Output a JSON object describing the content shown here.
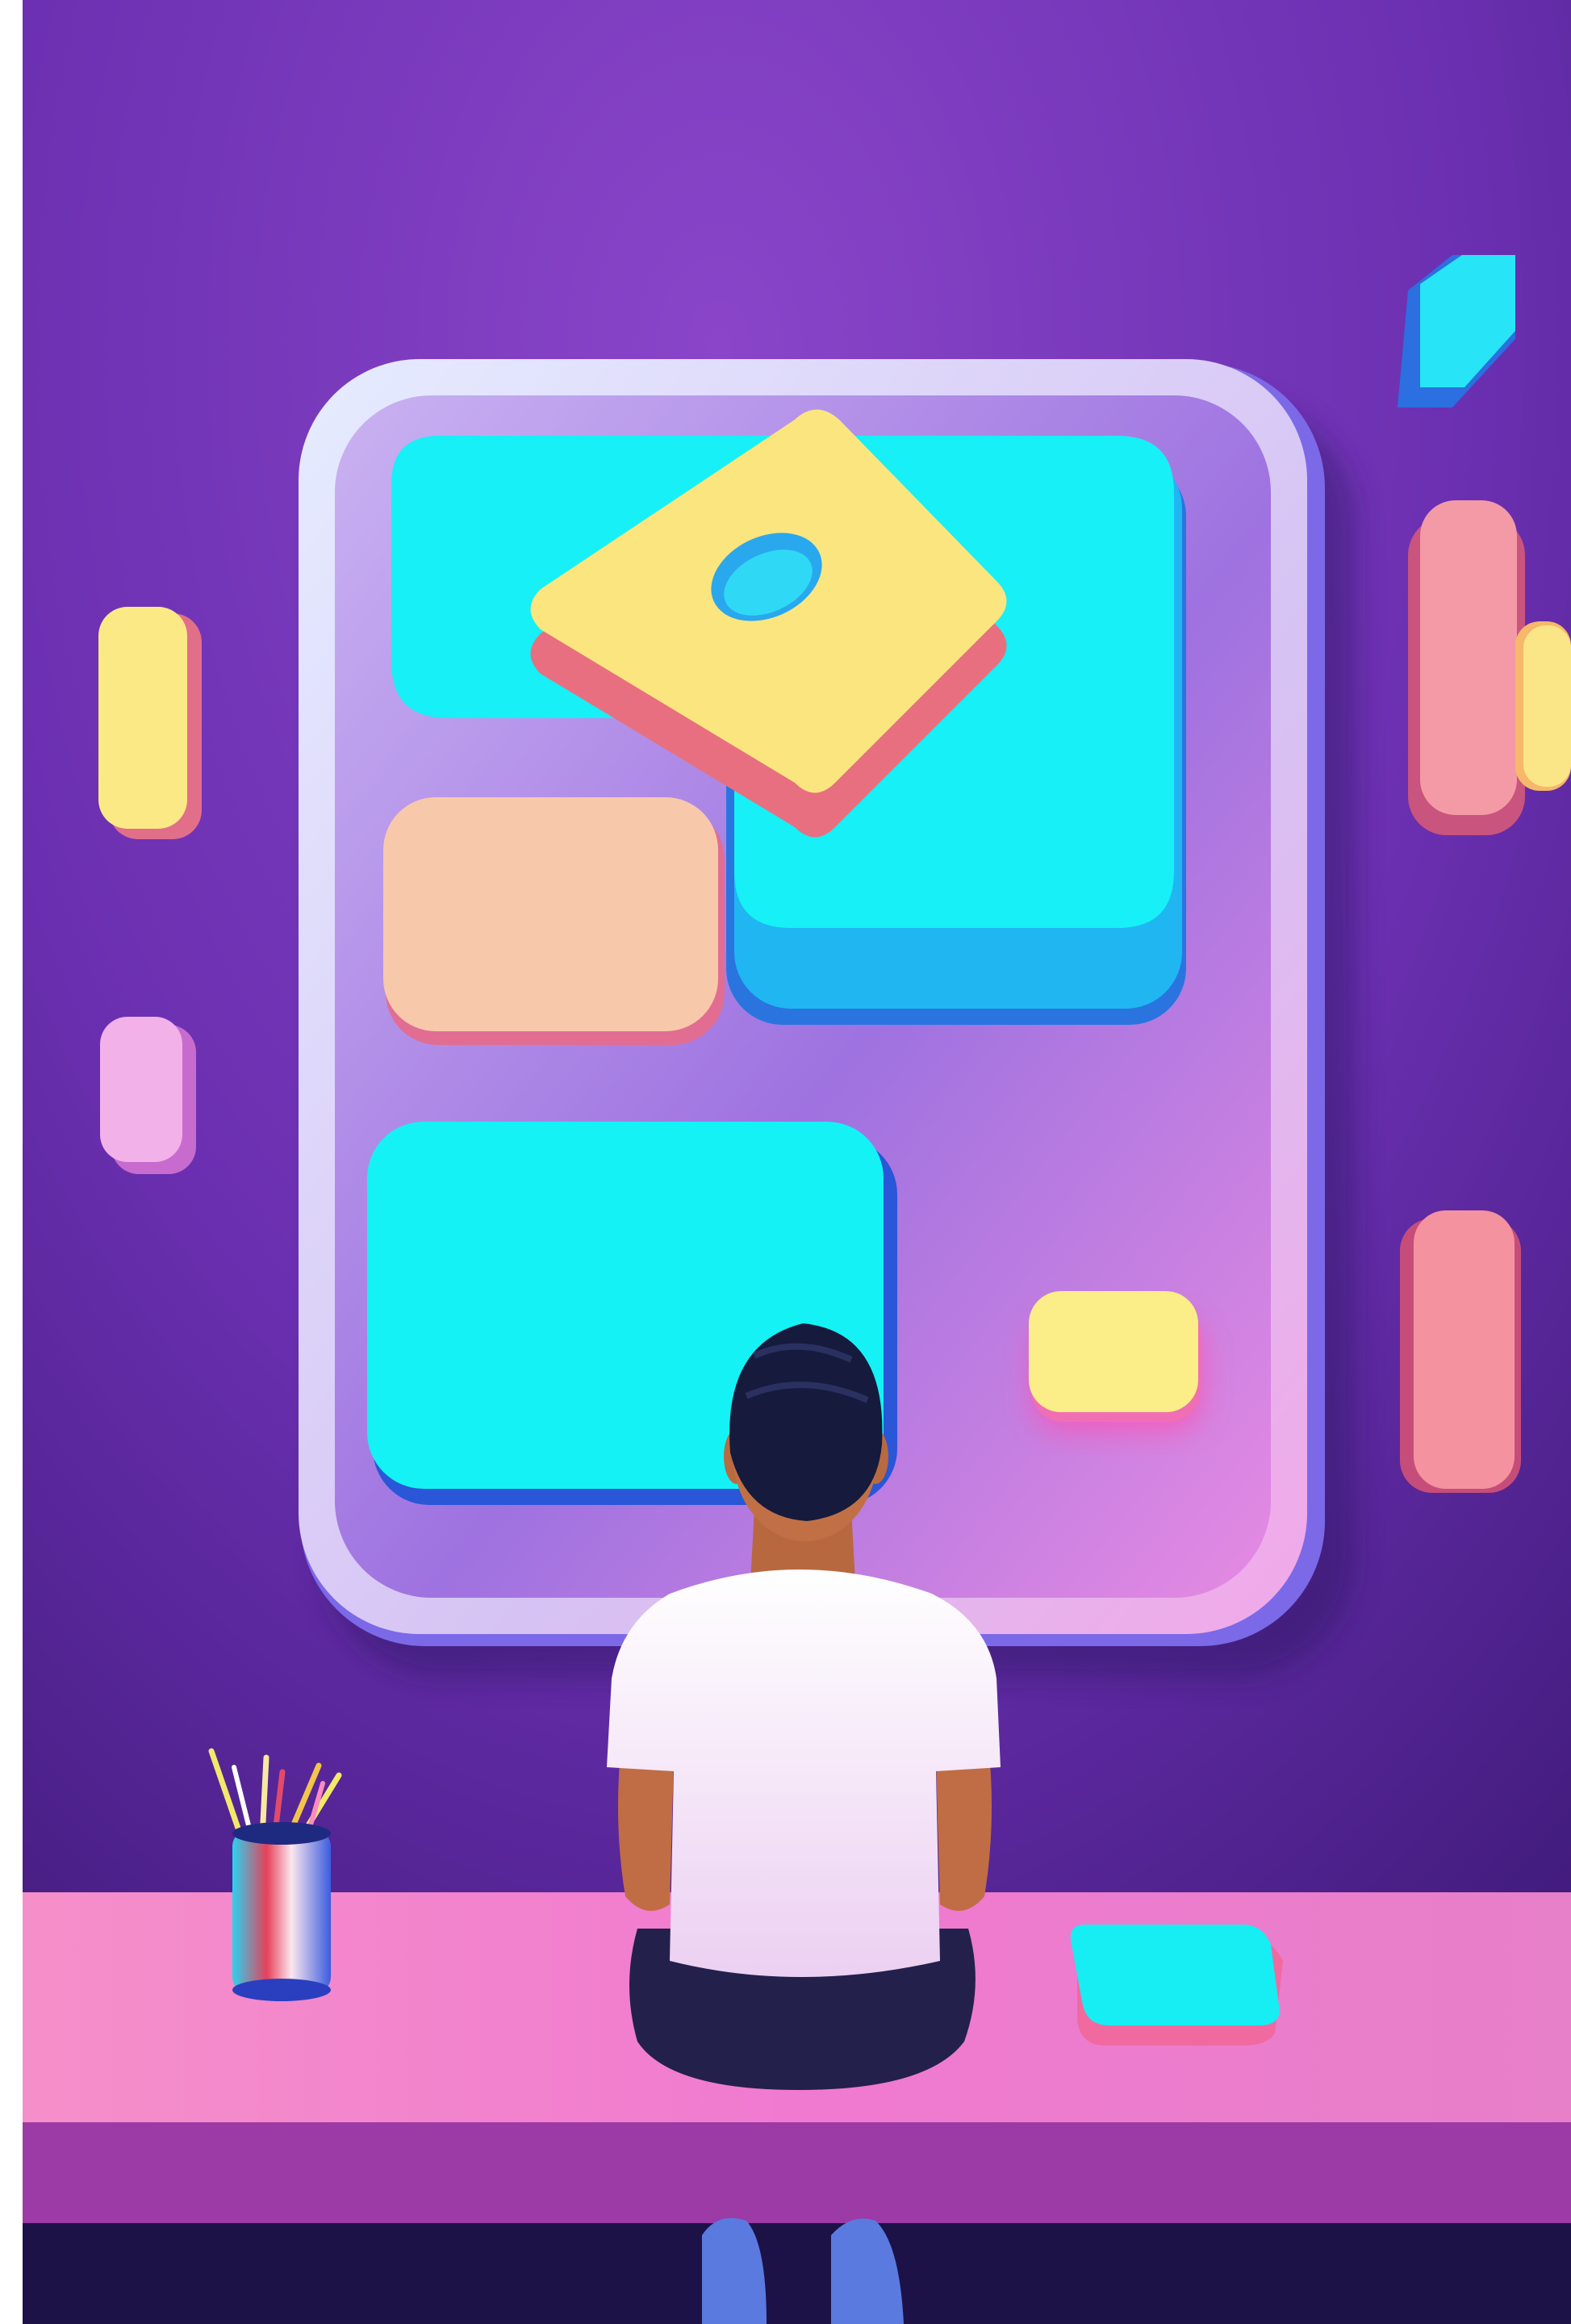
{
  "colors": {
    "wall_light": "#8a45c9",
    "wall_dark": "#4a1f86",
    "board_frame": "#dcd2f7",
    "board_face": "#b58ae8",
    "cyan": "#16f0f5",
    "cyan_shadow": "#2a8fe0",
    "yellow": "#fbec87",
    "peach": "#f8c7ab",
    "pink": "#f4949f",
    "lilac": "#efa9e6",
    "desk_top": "#f080cc",
    "desk_front": "#9e3aa8",
    "shirt": "#f5e9f6",
    "hair": "#151a3a",
    "skin": "#c9794f",
    "pants": "#202048"
  },
  "scene": {
    "background-wall": "wall",
    "icons": [
      "pencil-cup-icon",
      "tablet-icon",
      "diamond-tile-icon"
    ]
  }
}
